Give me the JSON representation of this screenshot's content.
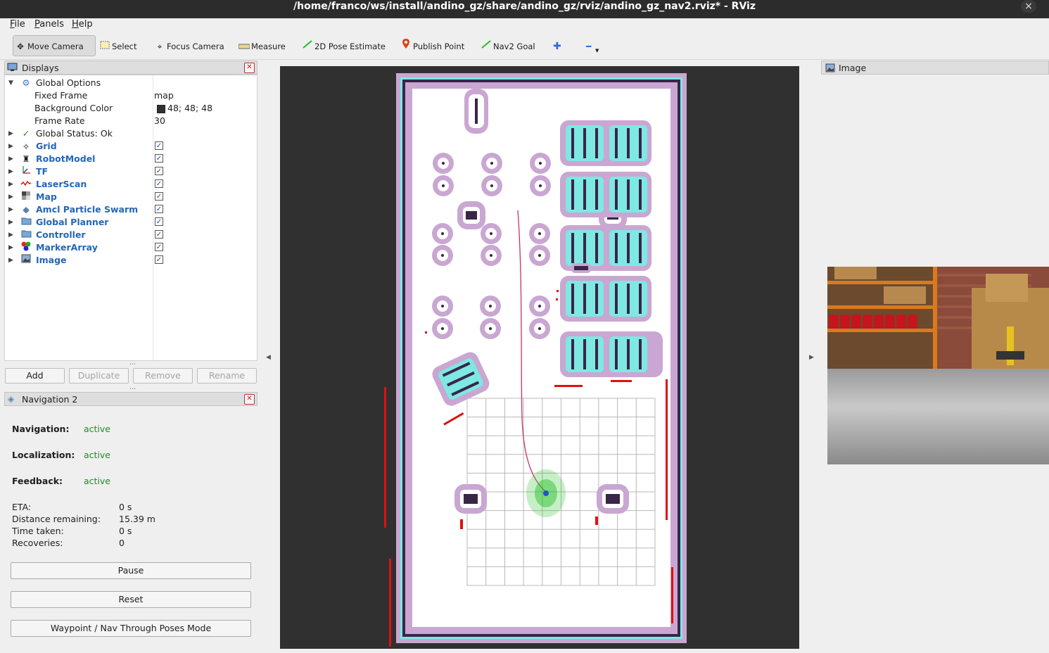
{
  "window": {
    "title": "/home/franco/ws/install/andino_gz/share/andino_gz/rviz/andino_gz_nav2.rviz* - RViz",
    "close_glyph": "×"
  },
  "menu": {
    "file": "File",
    "panels": "Panels",
    "help": "Help"
  },
  "toolbar": {
    "move_camera": "Move Camera",
    "select": "Select",
    "focus_camera": "Focus Camera",
    "measure": "Measure",
    "pose_estimate": "2D Pose Estimate",
    "publish_point": "Publish Point",
    "nav2_goal": "Nav2 Goal",
    "add_glyph": "✚",
    "remove_glyph": "━"
  },
  "displays": {
    "title": "Displays",
    "global_options": {
      "label": "Global Options",
      "fixed_frame_label": "Fixed Frame",
      "fixed_frame": "map",
      "background_color_label": "Background Color",
      "background_color": "48; 48; 48",
      "background_swatch": "#303030",
      "frame_rate_label": "Frame Rate",
      "frame_rate": "30"
    },
    "global_status": "Global Status: Ok",
    "items": [
      {
        "label": "Grid",
        "checked": true
      },
      {
        "label": "RobotModel",
        "checked": true
      },
      {
        "label": "TF",
        "checked": true
      },
      {
        "label": "LaserScan",
        "checked": true
      },
      {
        "label": "Map",
        "checked": true
      },
      {
        "label": "Amcl Particle Swarm",
        "checked": true
      },
      {
        "label": "Global Planner",
        "checked": true
      },
      {
        "label": "Controller",
        "checked": true
      },
      {
        "label": "MarkerArray",
        "checked": true
      },
      {
        "label": "Image",
        "checked": true
      }
    ],
    "buttons": {
      "add": "Add",
      "duplicate": "Duplicate",
      "remove": "Remove",
      "rename": "Rename"
    }
  },
  "nav2": {
    "title": "Navigation 2",
    "navigation_label": "Navigation:",
    "navigation": "active",
    "localization_label": "Localization:",
    "localization": "active",
    "feedback_label": "Feedback:",
    "feedback": "active",
    "eta_label": "ETA:",
    "eta": "0 s",
    "distance_label": "Distance remaining:",
    "distance": "15.39 m",
    "time_label": "Time taken:",
    "time": "0 s",
    "recoveries_label": "Recoveries:",
    "recoveries": "0",
    "pause": "Pause",
    "reset": "Reset",
    "waypoint": "Waypoint / Nav Through Poses Mode"
  },
  "image_panel": {
    "title": "Image"
  },
  "colors": {
    "accent": "#2466b8",
    "active": "#248a24",
    "viewport_bg": "#303030"
  },
  "check_glyph": "✓"
}
